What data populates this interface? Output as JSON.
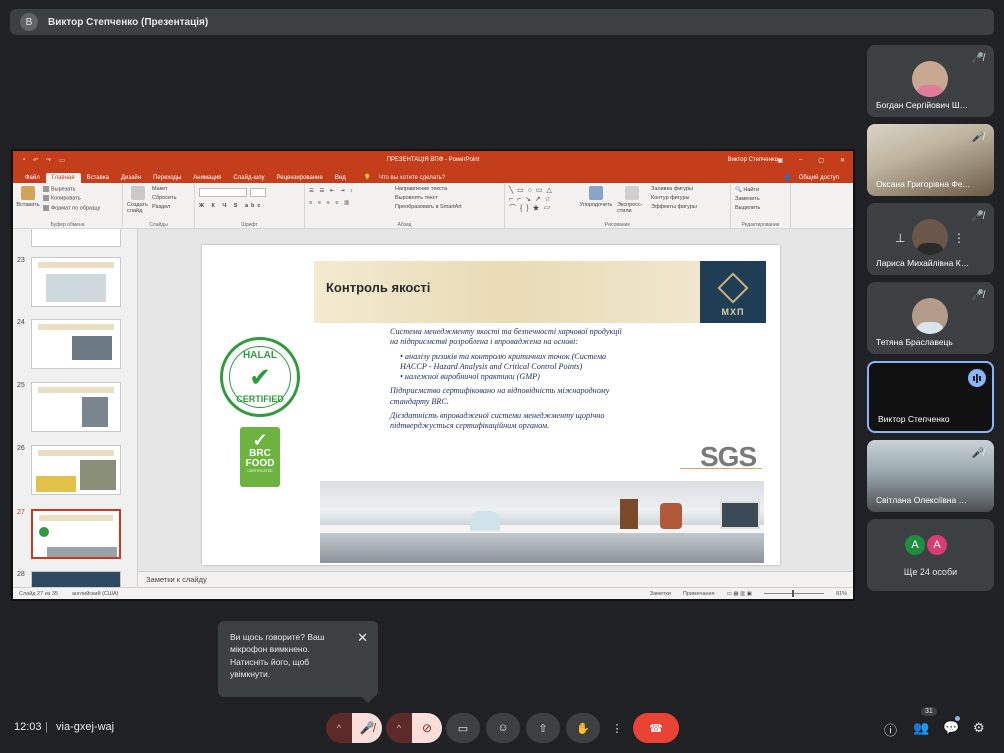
{
  "meeting": {
    "presenter_initial": "В",
    "presenter_title": "Виктор Степченко (Презентація)",
    "time": "12:03",
    "separator": "|",
    "code": "via-gxej-waj"
  },
  "ppt": {
    "doc_title": "ПРЕЗЕНТАЦІЯ ВПФ - PowerPoint",
    "user": "Виктор Степченко",
    "tabs": [
      "Файл",
      "Главная",
      "Вставка",
      "Дизайн",
      "Переходы",
      "Анимация",
      "Слайд-шоу",
      "Рецензирование",
      "Вид"
    ],
    "tell_me": "Что вы хотите сделать?",
    "share": "Общий доступ",
    "ribbon": {
      "paste": "Вставить",
      "cut": "Вырезать",
      "copy": "Копировать",
      "format_painter": "Формат по образцу",
      "clipboard": "Буфер обмена",
      "new_slide": "Создать слайд",
      "layout": "Макет",
      "reset": "Сбросить",
      "section": "Раздел",
      "slides": "Слайды",
      "font": "Шрифт",
      "paragraph": "Абзац",
      "text_dir": "Направление текста",
      "align_text": "Выровнять текст",
      "smartart": "Преобразовать в SmartArt",
      "arrange": "Упорядочить",
      "quick_styles": "Экспресс-стили",
      "drawing": "Рисование",
      "fill": "Заливка фигуры",
      "outline": "Контур фигуры",
      "effects": "Эффекты фигуры",
      "find": "Найти",
      "replace": "Заменить",
      "select": "Выделить",
      "editing": "Редактирование"
    },
    "thumbs": [
      "23",
      "24",
      "25",
      "26",
      "27",
      "28"
    ],
    "slide": {
      "title": "Контроль якості",
      "logo": "МХП",
      "p1": "Система менеджменту якості та безпечності харчової продукції на підприємстві розроблена і впроваджена на основі:",
      "bullets": [
        "аналізу ризиків та контролю критичних точок (Система HACCP - Hazard Analysis and Critical Control Points)",
        "належної виробничої практики (GMP)"
      ],
      "p2": "Підприємство сертифіковано на відповідність міжнародному стандарту BRC.",
      "p3": "Дієздатність впровадженої системи менеджменту щорічно підтверджується сертифікаційним органом.",
      "halal_top": "HALAL",
      "halal_bottom": "CERTIFIED",
      "brc1": "BRC",
      "brc2": "FOOD",
      "brc3": "CERTIFICATED",
      "sgs": "SGS"
    },
    "notes": "Заметки к слайду",
    "status_left": "Слайд 27 из 35",
    "status_lang": "английский (США)",
    "status_notes": "Заметки",
    "status_comments": "Примечания",
    "zoom": "81%"
  },
  "participants": [
    {
      "name": "Богдан Сергійович Ша...",
      "muted": true
    },
    {
      "name": "Оксана Григорівна Фе...",
      "muted": true
    },
    {
      "name": "Лариса Михайлівна Ку...",
      "muted": true
    },
    {
      "name": "Тетяна Браславець",
      "muted": true
    },
    {
      "name": "Виктор Степченко",
      "muted": false
    },
    {
      "name": "Світлана Олексіївна Ус...",
      "muted": true
    }
  ],
  "more": {
    "a1": "А",
    "a2": "А",
    "label": "Ще 24 особи"
  },
  "toast": {
    "text": "Ви щось говорите? Ваш мікрофон вимкнено. Натисніть його, щоб увімкнути.",
    "close": "✕"
  },
  "controls": {
    "people_count": "31"
  },
  "colors": {
    "accent": "#8ab4f8",
    "ppt": "#c43e1c",
    "end_call": "#ea4335"
  }
}
